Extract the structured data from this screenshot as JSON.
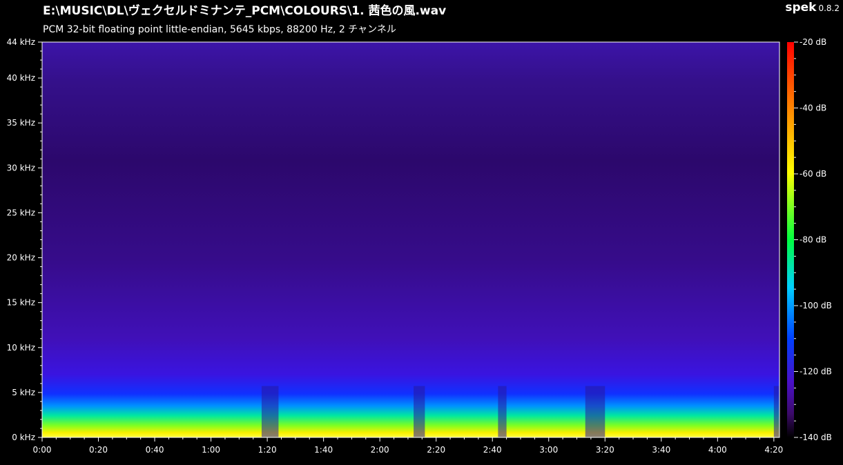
{
  "header": {
    "file_path": "E:\\MUSIC\\DL\\ヴェクセルドミナンテ_PCM\\COLOURS\\1. 茜色の風.wav",
    "audio_info": "PCM 32-bit floating point little-endian, 5645 kbps, 88200 Hz, 2 チャンネル",
    "app_name": "spek",
    "app_version": "0.8.2"
  },
  "chart_data": {
    "type": "heatmap",
    "title": "E:\\MUSIC\\DL\\ヴェクセルドミナンテ_PCM\\COLOURS\\1. 茜色の風.wav",
    "subtitle": "PCM 32-bit floating point little-endian, 5645 kbps, 88200 Hz, 2 チャンネル",
    "x_axis": {
      "unit": "time",
      "range_seconds": [
        0,
        262
      ],
      "ticks": [
        "0:00",
        "0:20",
        "0:40",
        "1:00",
        "1:20",
        "1:40",
        "2:00",
        "2:20",
        "2:40",
        "3:00",
        "3:20",
        "3:40",
        "4:00",
        "4:20"
      ]
    },
    "y_axis": {
      "unit": "kHz",
      "range": [
        0,
        44
      ],
      "ticks": [
        "0 kHz",
        "5 kHz",
        "10 kHz",
        "15 kHz",
        "20 kHz",
        "25 kHz",
        "30 kHz",
        "35 kHz",
        "40 kHz",
        "44 kHz"
      ]
    },
    "color_scale": {
      "unit": "dB",
      "range": [
        -140,
        -20
      ],
      "ticks": [
        "-20 dB",
        "-40 dB",
        "-60 dB",
        "-80 dB",
        "-100 dB",
        "-120 dB",
        "-140 dB"
      ],
      "colors": [
        "#000000",
        "#3c0a6a",
        "#4a10c8",
        "#0040ff",
        "#00d0ff",
        "#00ff40",
        "#ffff00",
        "#ff8000",
        "#ff0000"
      ]
    },
    "spectral_profile": {
      "energy_cutoff_khz": [
        9,
        10
      ],
      "quiet_sections_seconds": [
        [
          78,
          84
        ],
        [
          132,
          136
        ],
        [
          162,
          165
        ],
        [
          193,
          200
        ],
        [
          260,
          262
        ]
      ]
    }
  }
}
